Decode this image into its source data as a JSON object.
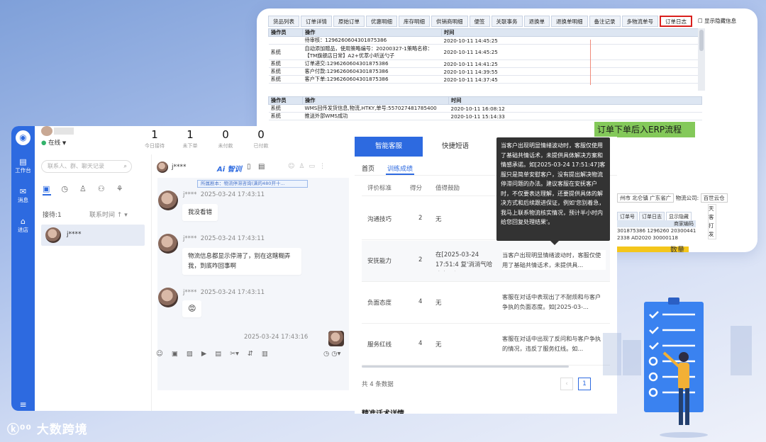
{
  "erp": {
    "tabs": [
      "货品列表",
      "订单详情",
      "原始订单",
      "优惠明细",
      "库存明细",
      "供销商明细",
      "便签",
      "关联事务",
      "退换单",
      "退换单明细",
      "备注记录",
      "多物流单号",
      "订单日志",
      "显示隐藏信息"
    ],
    "active_tab": "订单日志",
    "log1": {
      "headers": [
        "操作员",
        "操作",
        "时间"
      ],
      "rows": [
        {
          "op": "",
          "action": "待审核：1296260604301875386",
          "time": "2020-10-11 14:45:25"
        },
        {
          "op": "系统",
          "action": "自动添加赠品，使用策略编号：20200327-1策略名称：【TM旗舰店日常】A2+优萃小听送勺子",
          "time": "2020-10-11 14:45:25"
        },
        {
          "op": "系统",
          "action": "订单递交:1296260604301875386",
          "time": "2020-10-11 14:41:25"
        },
        {
          "op": "系统",
          "action": "客户付款:1296260604301875386",
          "time": "2020-10-11 14:39:55"
        },
        {
          "op": "系统",
          "action": "客户下单:1296260604301875386",
          "time": "2020-10-11 14:37:45"
        }
      ]
    },
    "log2": {
      "headers": [
        "操作员",
        "操作",
        "时间"
      ],
      "rows": [
        {
          "op": "系统",
          "action": "WMS回传发货信息,物流,HTKY,单号:557027481785400",
          "time": "2020-10-11 16:08:12"
        },
        {
          "op": "系统",
          "action": "推送外部WMS成功",
          "time": "2020-10-11 15:14:33"
        }
      ]
    },
    "green_label": "订单下单后入ERP流程",
    "address_row": {
      "city": "州市 北仑镇 广东省广",
      "logistics_label": "物流公司:",
      "logistics_value": "百世云仓"
    },
    "mini_tabs": [
      "订单号",
      "订单日志",
      "显示隐藏"
    ],
    "mini_headers": [
      "",
      "商家编码"
    ],
    "mini_rows": [
      [
        "301875386",
        "1296260",
        "20300441"
      ],
      [
        "2338",
        "AD2020",
        "30000118"
      ]
    ],
    "side_chars": [
      "天",
      "客",
      "打",
      "发"
    ],
    "yellow_text": "数量"
  },
  "chat": {
    "agent_name": "",
    "status": "在线",
    "stats": [
      {
        "value": "1",
        "label": "今日接待"
      },
      {
        "value": "1",
        "label": "未下单"
      },
      {
        "value": "0",
        "label": "未付款"
      },
      {
        "value": "0",
        "label": "已付款"
      }
    ],
    "nav": [
      {
        "label": "工作台"
      },
      {
        "label": "消息"
      },
      {
        "label": "进店"
      }
    ],
    "search_placeholder": "联系人、群、聊天记录",
    "queue_label": "接待:1",
    "sort_label": "联系时间",
    "session_name": "j****",
    "header_name": "j****",
    "ai_label": "Ai 智训",
    "script_hint": "所属剧本：物流停滞咨询(满的480开十...",
    "messages": [
      {
        "name": "j****",
        "time": "2025-03-24 17:43:11",
        "text": "我没看错"
      },
      {
        "name": "j****",
        "time": "2025-03-24 17:43:11",
        "text": "物流信息都显示停滞了，别在这瞎糊弄我，到底咋回事啊"
      },
      {
        "name": "j****",
        "time": "2025-03-24 17:43:11",
        "text": "😡"
      }
    ],
    "reply_time": "2025-03-24 17:43:16"
  },
  "qc": {
    "tabs": [
      "智能客服",
      "快捷短语"
    ],
    "subtabs": [
      "首页",
      "训练成绩"
    ],
    "headers": [
      "评价标准",
      "得分",
      "值得鼓励"
    ],
    "rows": [
      {
        "criteria": "沟通技巧",
        "score": "2",
        "encourage": "无",
        "comment": ""
      },
      {
        "criteria": "安抚能力",
        "score": "2",
        "encourage": "在[2025-03-24 17:51:4 复'消消气哈 确实已经",
        "comment": "当客户出现明显情绪波动时，客服仅使用了基础共情话术，未提供具..."
      },
      {
        "criteria": "负面态度",
        "score": "4",
        "encourage": "无",
        "comment": "客服在对话中表现出了不耐烦和与客户争执的负面态度。如[2025-03-..."
      },
      {
        "criteria": "服务红线",
        "score": "4",
        "encourage": "无",
        "comment": "客服在对话中出现了反问和与客户争执的情况，违反了服务红线。如..."
      }
    ],
    "total": "共 4 条数据",
    "page": "1",
    "tooltip": "当客户出现明显情绪波动时，客服仅使用了基础共情话术，未提供具体解决方案和情感承诺。如[2025-03-24 17:51:47]客服只是简单安慰客户，没有提出解决物流停滞问题的办法。建议客服在安抚客户时，不仅要表达理解，还要提供具体的解决方式和后续跟进保证，例如'您别着急，我马上联系物流核实情况，预计半小时内给您回复处理结果'。",
    "bottom_peek": "精准话术详情"
  },
  "brand": {
    "name": "大数跨境"
  }
}
